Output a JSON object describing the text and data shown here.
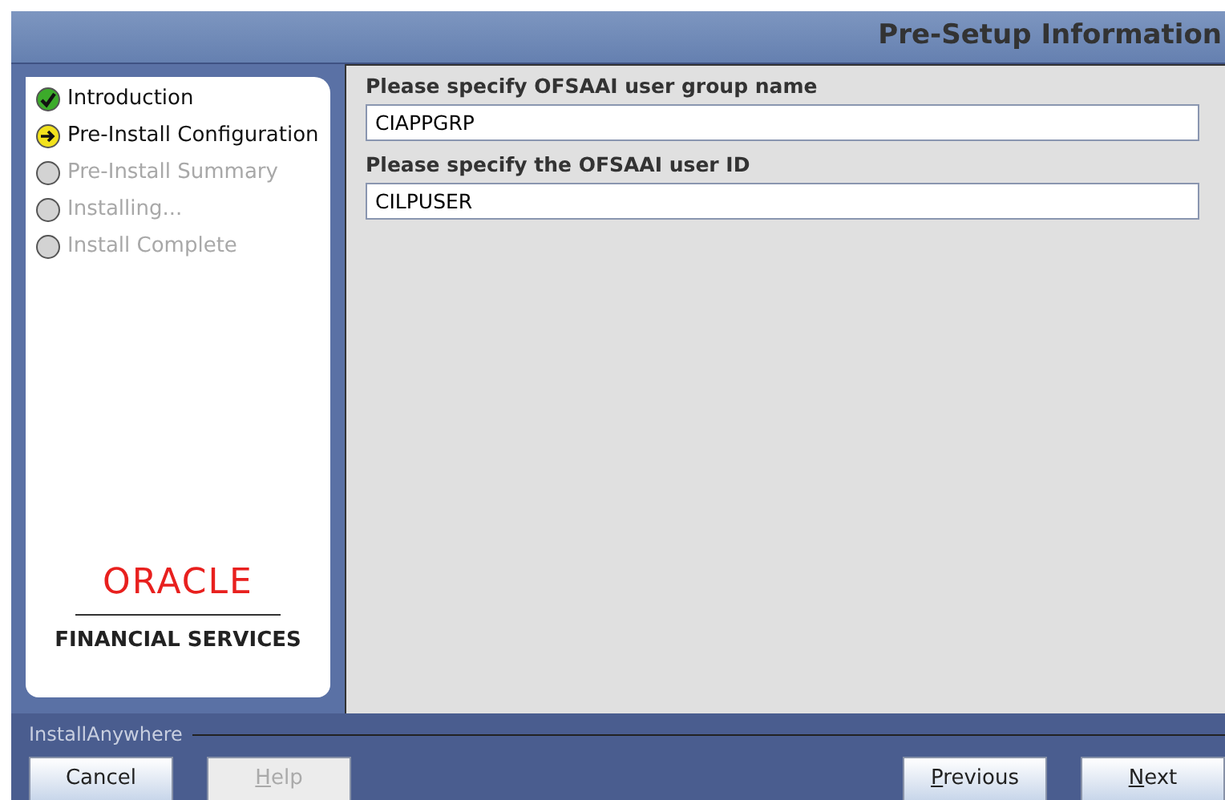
{
  "window": {
    "title": "Pre-Setup Information"
  },
  "steps": [
    {
      "label": "Introduction",
      "completed": true,
      "current": false
    },
    {
      "label": "Pre-Install Configuration",
      "completed": false,
      "current": true
    },
    {
      "label": "Pre-Install Summary",
      "completed": false,
      "current": false
    },
    {
      "label": "Installing...",
      "completed": false,
      "current": false
    },
    {
      "label": "Install Complete",
      "completed": false,
      "current": false
    }
  ],
  "logo": {
    "brand": "ORACLE",
    "subtitle": "FINANCIAL SERVICES"
  },
  "fields": [
    {
      "label": "Please specify OFSAAI user group name",
      "value": "CIAPPGRP"
    },
    {
      "label": "Please specify the OFSAAI user ID",
      "value": "CILPUSER"
    }
  ],
  "footer": {
    "vendor": "InstallAnywhere"
  },
  "left_buttons": [
    {
      "label": "Cancel",
      "disabled": false,
      "underline_first": false
    },
    {
      "label": "Help",
      "disabled": true,
      "underline_first": true
    }
  ],
  "right_buttons": [
    {
      "label": "Previous",
      "disabled": false,
      "underline_first": true
    },
    {
      "label": "Next",
      "disabled": false,
      "underline_first": true
    }
  ]
}
